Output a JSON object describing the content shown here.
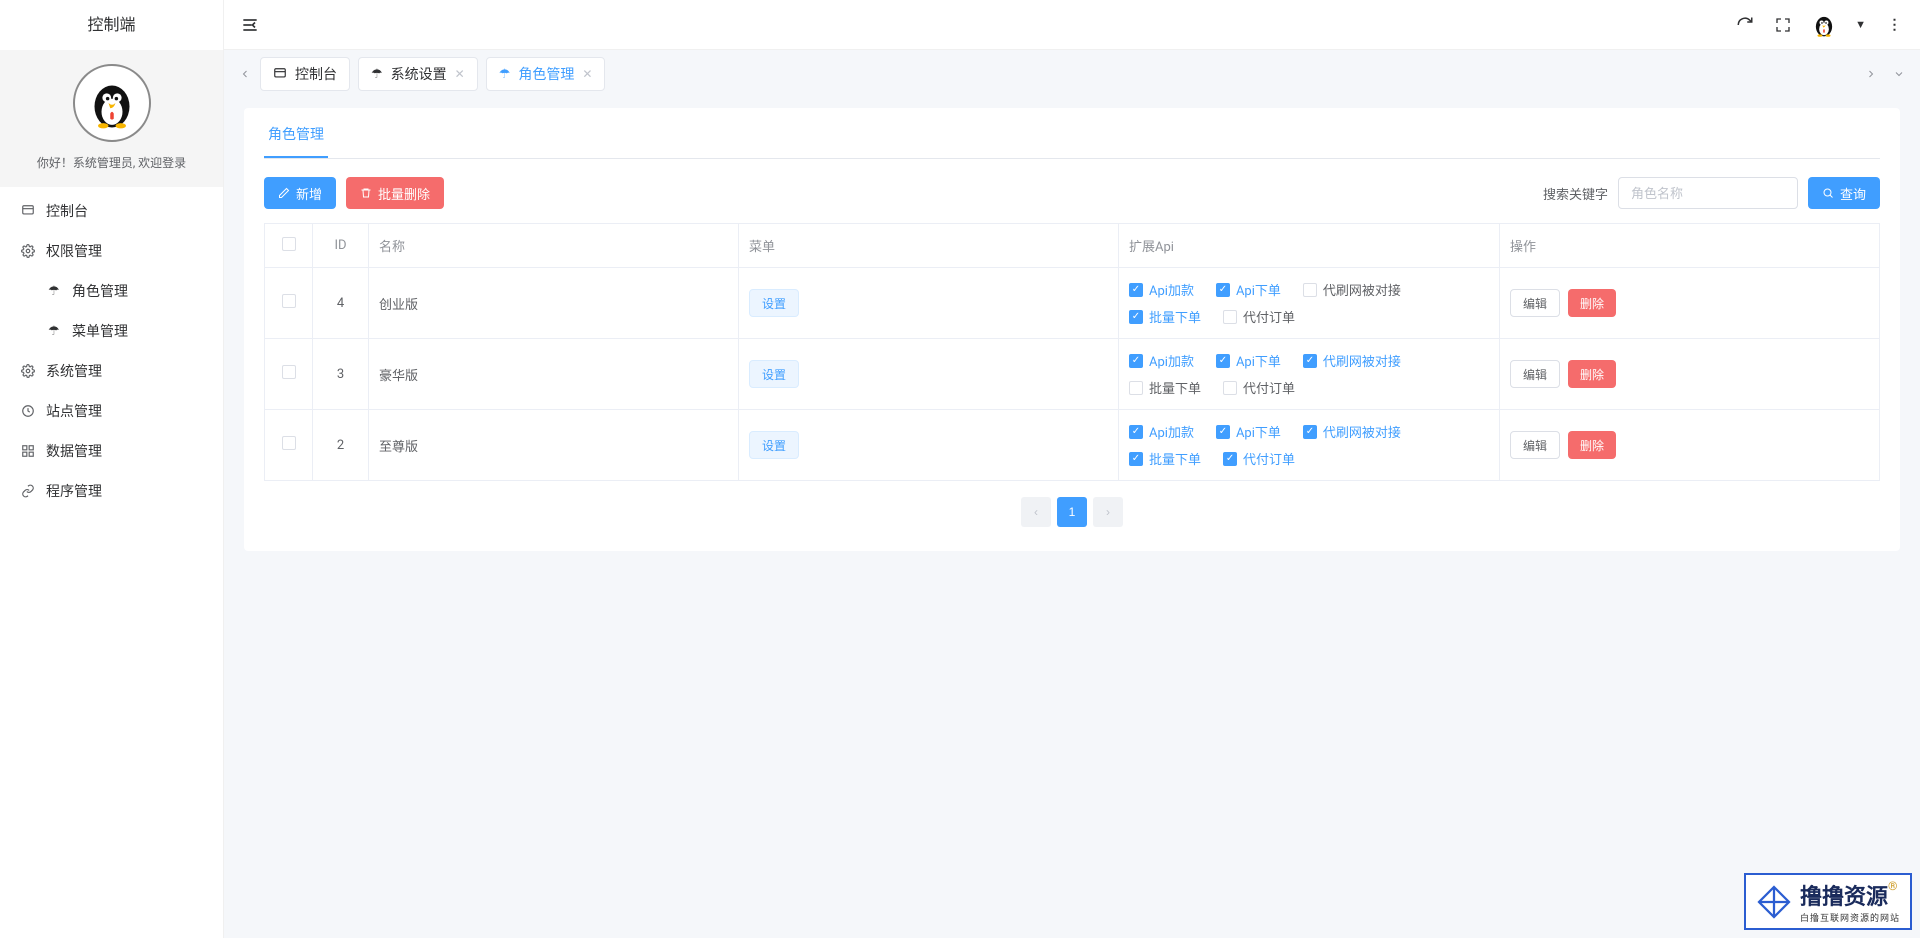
{
  "app_title": "控制端",
  "profile": {
    "welcome": "你好！系统管理员, 欢迎登录"
  },
  "sidebar": {
    "items": [
      {
        "icon": "dashboard",
        "label": "控制台"
      },
      {
        "icon": "gear",
        "label": "权限管理",
        "children": [
          {
            "icon": "umbrella",
            "label": "角色管理"
          },
          {
            "icon": "umbrella",
            "label": "菜单管理"
          }
        ]
      },
      {
        "icon": "gear",
        "label": "系统管理"
      },
      {
        "icon": "clock",
        "label": "站点管理"
      },
      {
        "icon": "grid",
        "label": "数据管理"
      },
      {
        "icon": "link",
        "label": "程序管理"
      }
    ]
  },
  "tabs": [
    {
      "icon": "dashboard",
      "label": "控制台",
      "closable": false,
      "active": false
    },
    {
      "icon": "umbrella",
      "label": "系统设置",
      "closable": true,
      "active": false
    },
    {
      "icon": "umbrella",
      "label": "角色管理",
      "closable": true,
      "active": true
    }
  ],
  "page": {
    "title": "角色管理",
    "toolbar": {
      "add_label": "新增",
      "batch_delete_label": "批量删除",
      "search_label": "搜索关键字",
      "search_placeholder": "角色名称",
      "search_btn": "查询"
    },
    "columns": {
      "id": "ID",
      "name": "名称",
      "menu": "菜单",
      "api": "扩展Api",
      "op": "操作"
    },
    "menu_btn": "设置",
    "row_ops": {
      "edit": "编辑",
      "delete": "删除"
    },
    "rows": [
      {
        "id": "4",
        "name": "创业版",
        "apis": [
          {
            "label": "Api加款",
            "on": true
          },
          {
            "label": "Api下单",
            "on": true
          },
          {
            "label": "代刷网被对接",
            "on": false
          },
          {
            "label": "批量下单",
            "on": true
          },
          {
            "label": "代付订单",
            "on": false
          }
        ]
      },
      {
        "id": "3",
        "name": "豪华版",
        "apis": [
          {
            "label": "Api加款",
            "on": true
          },
          {
            "label": "Api下单",
            "on": true
          },
          {
            "label": "代刷网被对接",
            "on": true
          },
          {
            "label": "批量下单",
            "on": false
          },
          {
            "label": "代付订单",
            "on": false
          }
        ]
      },
      {
        "id": "2",
        "name": "至尊版",
        "apis": [
          {
            "label": "Api加款",
            "on": true
          },
          {
            "label": "Api下单",
            "on": true
          },
          {
            "label": "代刷网被对接",
            "on": true
          },
          {
            "label": "批量下单",
            "on": true
          },
          {
            "label": "代付订单",
            "on": true
          }
        ]
      }
    ],
    "pagination": {
      "current": "1"
    }
  },
  "watermark": {
    "line1": "撸撸资源",
    "line2": "白撸互联网资源的网站"
  }
}
